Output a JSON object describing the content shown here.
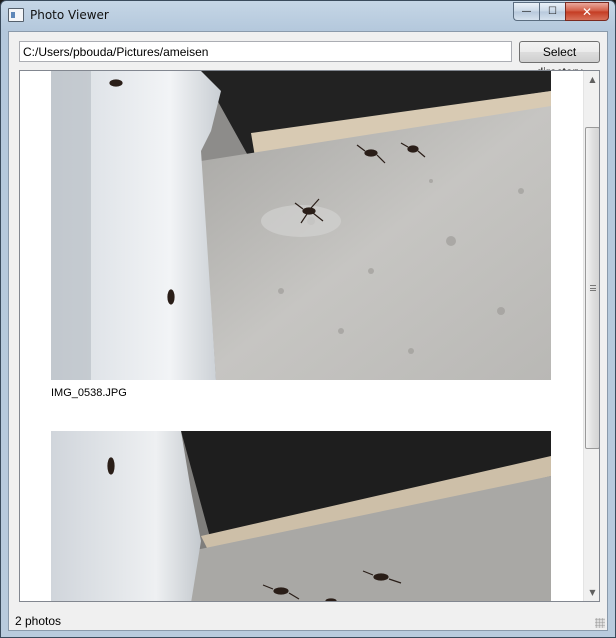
{
  "window": {
    "title": "Photo Viewer",
    "icon": "app-window-icon"
  },
  "caption_buttons": {
    "minimize": "—",
    "maximize": "☐",
    "close": "✕"
  },
  "toolbar": {
    "path_value": "C:/Users/pbouda/Pictures/ameisen",
    "select_label": "Select directory"
  },
  "photos": [
    {
      "filename": "IMG_0538.JPG"
    },
    {
      "filename": ""
    }
  ],
  "scrollbar": {
    "up": "▲",
    "down": "▼"
  },
  "status": {
    "text": "2 photos"
  }
}
